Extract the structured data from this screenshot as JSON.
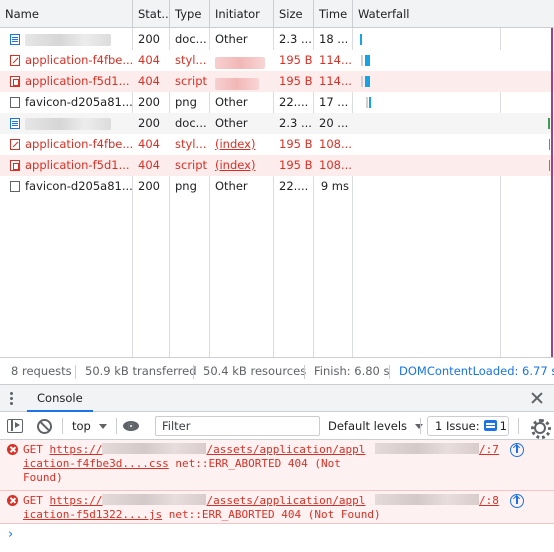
{
  "network": {
    "columns": {
      "name": "Name",
      "status": "Stat..",
      "type": "Type",
      "initiator": "Initiator",
      "size": "Size",
      "time": "Time",
      "waterfall": "Waterfall"
    },
    "rows": [
      {
        "name": "",
        "status": "200",
        "type": "doc...",
        "initiator": "Other",
        "size": "2.3 ...",
        "time": "18 ...",
        "kind": "doc",
        "error": false
      },
      {
        "name": "application-f4fbe...",
        "status": "404",
        "type": "styl...",
        "initiator": "",
        "size": "195 B",
        "time": "114...",
        "kind": "css",
        "error": true
      },
      {
        "name": "application-f5d1...",
        "status": "404",
        "type": "script",
        "initiator": "",
        "size": "195 B",
        "time": "114...",
        "kind": "js",
        "error": true
      },
      {
        "name": "favicon-d205a81...",
        "status": "200",
        "type": "png",
        "initiator": "Other",
        "size": "22....",
        "time": "17 ...",
        "kind": "png",
        "error": false
      },
      {
        "name": "",
        "status": "200",
        "type": "doc...",
        "initiator": "Other",
        "size": "2.3 ...",
        "time": "20 ...",
        "kind": "doc",
        "error": false
      },
      {
        "name": "application-f4fbe...",
        "status": "404",
        "type": "styl...",
        "initiator": "(index)",
        "size": "195 B",
        "time": "108...",
        "kind": "css",
        "error": true
      },
      {
        "name": "application-f5d1...",
        "status": "404",
        "type": "script",
        "initiator": "(index)",
        "size": "195 B",
        "time": "108...",
        "kind": "js",
        "error": true
      },
      {
        "name": "favicon-d205a81...",
        "status": "200",
        "type": "png",
        "initiator": "Other",
        "size": "22....",
        "time": "9 ms",
        "kind": "png",
        "error": false
      }
    ]
  },
  "status_bar": {
    "requests": "8 requests",
    "transferred": "50.9 kB transferred",
    "resources": "50.4 kB resources",
    "finish": "Finish: 6.80 s",
    "dom_content_loaded": "DOMContentLoaded: 6.77 s"
  },
  "drawer": {
    "tab_label": "Console"
  },
  "console_toolbar": {
    "context": "top",
    "filter_placeholder": "Filter",
    "levels": "Default levels",
    "issues_prefix": "1 Issue:",
    "issues_count": "1"
  },
  "messages": [
    {
      "method": "GET",
      "url_prefix": "https://",
      "url_path": "/assets/application/appl",
      "url_rest": "ication-f4fbe3d....css",
      "error_text": "net::ERR_ABORTED 404 (Not",
      "error_text_2": "Found)",
      "source_suffix": "/:7"
    },
    {
      "method": "GET",
      "url_prefix": "https://",
      "url_path": "/assets/application/appl",
      "url_rest": "ication-f5d1322....js",
      "error_text": "net::ERR_ABORTED 404 (Not Found)",
      "source_suffix": "/:8"
    }
  ],
  "colors": {
    "error_red": "#d93025",
    "accent_blue": "#1a73e8"
  }
}
